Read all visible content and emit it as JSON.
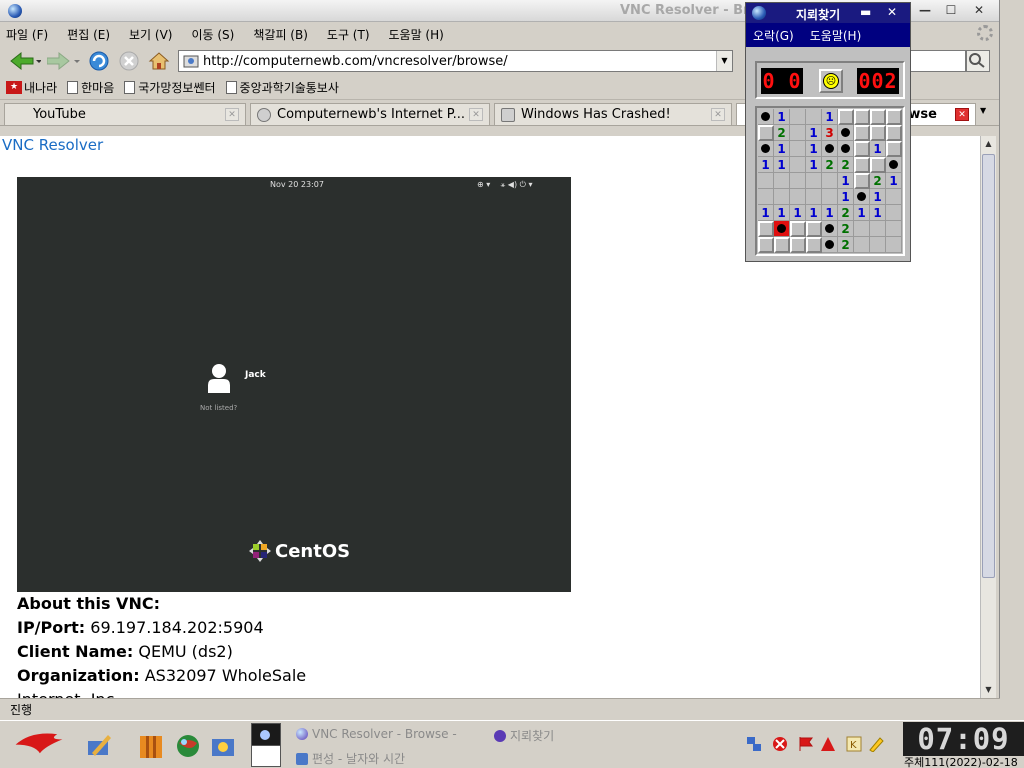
{
  "browser": {
    "window_title": "VNC Resolver - Br",
    "menu": [
      "파일 (F)",
      "편집 (E)",
      "보기 (V)",
      "이동 (S)",
      "책갈피 (B)",
      "도구 (T)",
      "도움말 (H)"
    ],
    "url": "http://computernewb.com/vncresolver/browse/",
    "bookmarks": [
      "내나라",
      "한마음",
      "국가망정보쎈터",
      "중앙과학기술통보사"
    ],
    "tabs": [
      {
        "label": "YouTube"
      },
      {
        "label": "Computernewb's Internet P..."
      },
      {
        "label": "Windows Has Crashed!"
      },
      {
        "label": "wse"
      }
    ],
    "status": "진행",
    "colors": {
      "link": "#1a6cc4",
      "vnc_bg": "#2b2f2d"
    }
  },
  "page": {
    "title": "VNC Resolver",
    "vnc": {
      "time": "Nov 20  23:07",
      "user": "Jack",
      "not_listed": "Not listed?",
      "os_logo": "CentOS"
    },
    "about_heading": "About this VNC:",
    "ip_label": "IP/Port:",
    "ip_value": "69.197.184.202:5904",
    "client_label": "Client Name:",
    "client_value": "QEMU (ds2)",
    "org_label": "Organization:",
    "org_value": "AS32097 WholeSale",
    "org_cont": "Internet, Inc"
  },
  "minesweeper": {
    "title": "지뢰찾기",
    "menu": [
      "오락(G)",
      "도움말(H)"
    ],
    "mines_left": "0 0",
    "timer": "002",
    "grid": [
      [
        "m",
        "1",
        "o",
        "o",
        "1",
        "c",
        "c",
        "c",
        "c"
      ],
      [
        "c",
        "2",
        "o",
        "1",
        "3",
        "m",
        "c",
        "c",
        "c"
      ],
      [
        "m",
        "1",
        "o",
        "1",
        "m",
        "m",
        "c",
        "1",
        "c"
      ],
      [
        "1",
        "1",
        "o",
        "1",
        "2",
        "2",
        "c",
        "c",
        "m"
      ],
      [
        "o",
        "o",
        "o",
        "o",
        "o",
        "1",
        "c",
        "2",
        "1"
      ],
      [
        "o",
        "o",
        "o",
        "o",
        "o",
        "1",
        "m",
        "1",
        "o"
      ],
      [
        "1",
        "1",
        "1",
        "1",
        "1",
        "2",
        "1",
        "1",
        "o"
      ],
      [
        "c",
        "x",
        "c",
        "c",
        "m",
        "2",
        "o",
        "o",
        "o"
      ],
      [
        "c",
        "c",
        "c",
        "c",
        "m",
        "2",
        "o",
        "o",
        "o"
      ]
    ]
  },
  "taskbar": {
    "tasks": [
      "VNC Resolver - Browse -",
      "지뢰찾기",
      "편성 - 날자와 시간"
    ],
    "clock": "07:09",
    "date": "주체111(2022)-02-18"
  }
}
